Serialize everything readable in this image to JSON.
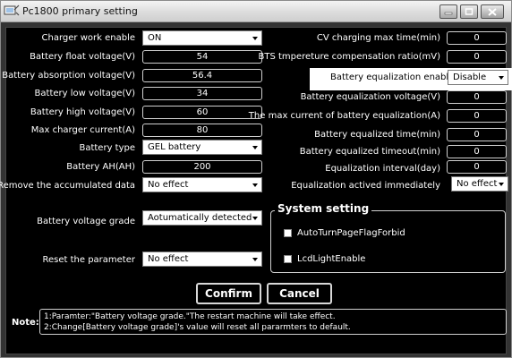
{
  "window": {
    "title": "Pc1800 primary setting"
  },
  "left": [
    {
      "label": "Charger work enable",
      "kind": "select",
      "value": "ON"
    },
    {
      "label": "Battery float voltage(V)",
      "kind": "field",
      "value": "54"
    },
    {
      "label": "Battery absorption voltage(V)",
      "kind": "field",
      "value": "56.4"
    },
    {
      "label": "Battery low voltage(V)",
      "kind": "field",
      "value": "34"
    },
    {
      "label": "Battery high voltage(V)",
      "kind": "field",
      "value": "60"
    },
    {
      "label": "Max charger current(A)",
      "kind": "field",
      "value": "80"
    },
    {
      "label": "Battery type",
      "kind": "select",
      "value": "GEL battery"
    },
    {
      "label": "Battery AH(AH)",
      "kind": "field",
      "value": "200"
    },
    {
      "label": "Remove the accumulated data",
      "kind": "select",
      "value": "No effect"
    }
  ],
  "grade": {
    "label": "Battery voltage grade",
    "value": "Aotumatically detected"
  },
  "reset": {
    "label": "Reset the parameter",
    "value": "No effect"
  },
  "right": [
    {
      "label": "CV charging max time(min)",
      "kind": "field",
      "value": "0"
    },
    {
      "label": "BTS tmpereture compensation ratio(mV)",
      "kind": "field",
      "value": "0"
    },
    {
      "label": "Battery equalization enable",
      "kind": "select",
      "value": "Disable"
    },
    {
      "label": "Battery equalization voltage(V)",
      "kind": "field",
      "value": "0"
    },
    {
      "label": "The max current of battery equalization(A)",
      "kind": "field",
      "value": "0"
    },
    {
      "label": "Battery equalized time(min)",
      "kind": "field",
      "value": "0"
    },
    {
      "label": "Battery equalized timeout(min)",
      "kind": "field",
      "value": "0"
    },
    {
      "label": "Equalization interval(day)",
      "kind": "field",
      "value": "0"
    },
    {
      "label": "Equalization actived immediately",
      "kind": "select",
      "value": "No effect"
    }
  ],
  "system": {
    "title": "System setting",
    "options": [
      {
        "label": "AutoTurnPageFlagForbid",
        "checked": false
      },
      {
        "label": "LcdLightEnable",
        "checked": false
      }
    ]
  },
  "buttons": {
    "confirm": "Confirm",
    "cancel": "Cancel"
  },
  "note": {
    "title": "Note:",
    "lines": [
      "1:Paramter:\"Battery voltage grade.\"The restart machine will take effect.",
      "2:Change[Battery voltage grade]'s value will reset all pararmters to default."
    ]
  }
}
